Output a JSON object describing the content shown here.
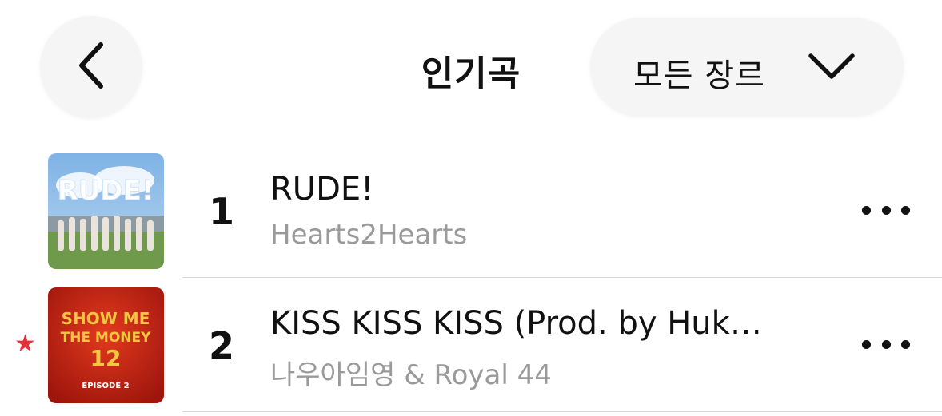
{
  "header": {
    "title": "인기곡",
    "genre_label": "모든 장르"
  },
  "songs": [
    {
      "rank": "1",
      "title": "RUDE!",
      "artist": "Hearts2Hearts",
      "art_text": "RUDE!",
      "explicit_star": false
    },
    {
      "rank": "2",
      "title": "KISS KISS KISS (Prod. by Huk…",
      "artist": "나우아임영 & Royal 44",
      "art_text_top": "SHOW ME",
      "art_text_mid": "THE MONEY",
      "art_text_num": "12",
      "art_text_bottom": "EPISODE 2",
      "explicit_star": true
    }
  ],
  "colors": {
    "accent_star": "#e5303a",
    "secondary_text": "#9a9a9a"
  }
}
